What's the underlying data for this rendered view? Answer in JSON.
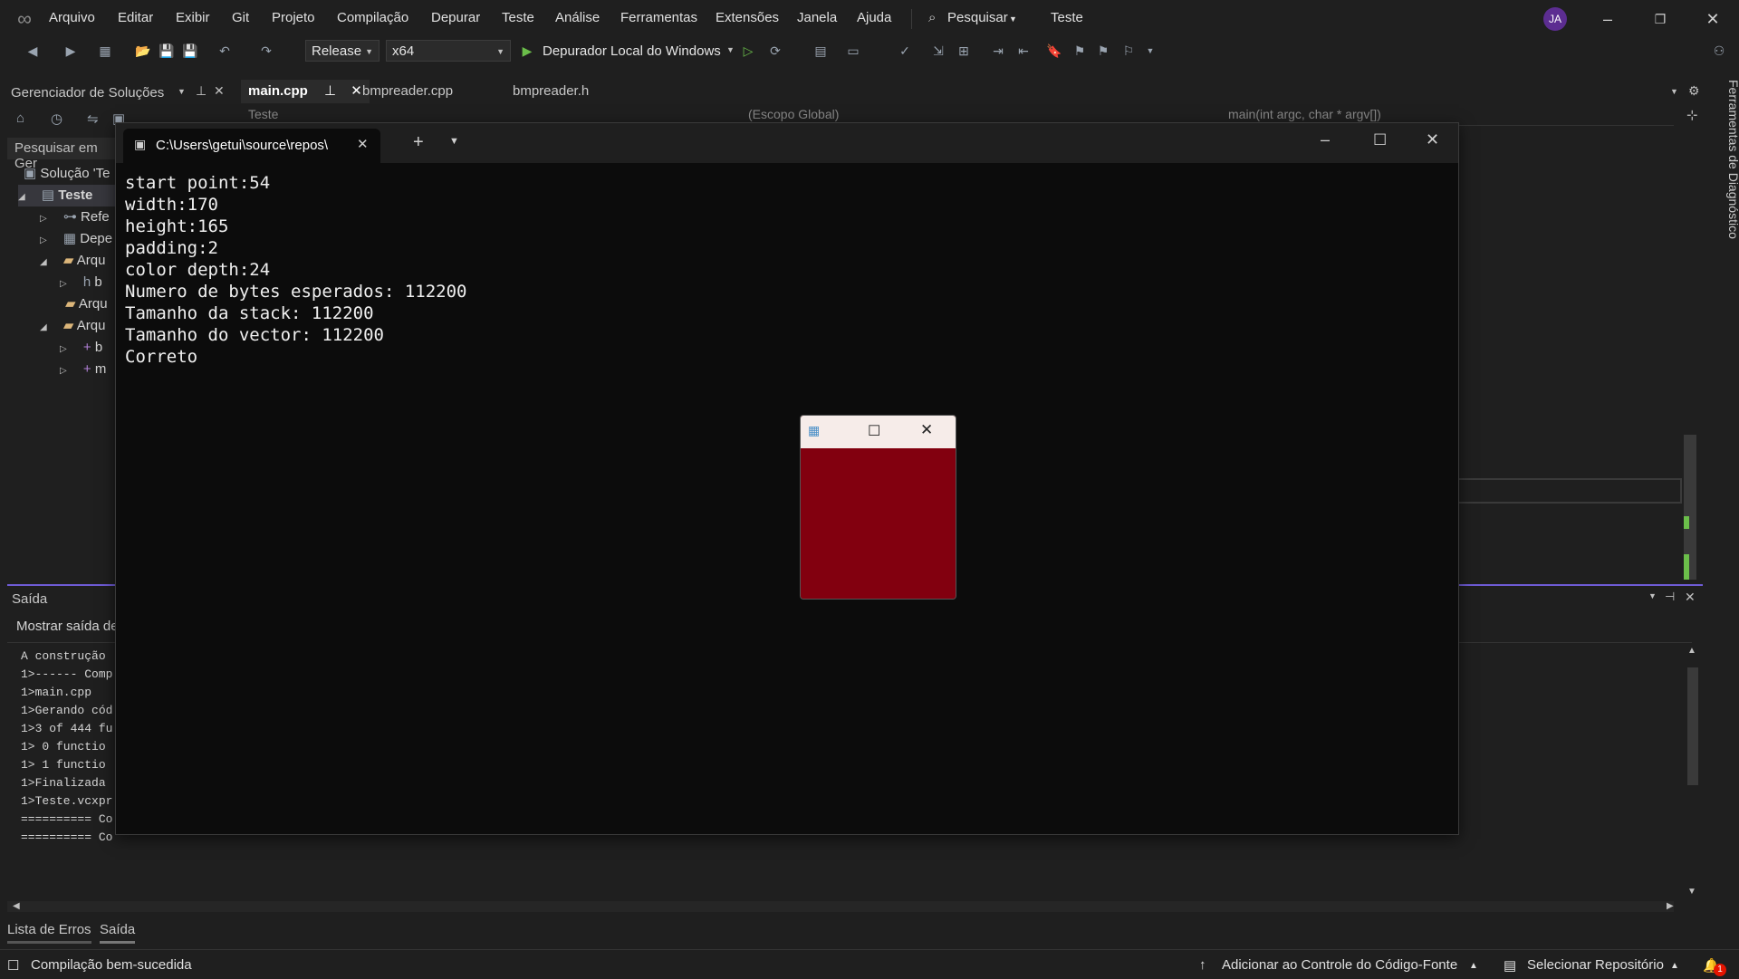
{
  "menu": {
    "items": [
      "Arquivo",
      "Editar",
      "Exibir",
      "Git",
      "Projeto",
      "Compilação",
      "Depurar",
      "Teste",
      "Análise",
      "Ferramentas",
      "Extensões",
      "Janela",
      "Ajuda"
    ],
    "search_label": "Pesquisar",
    "solution_name": "Teste",
    "avatar_initials": "JA"
  },
  "toolbar": {
    "config": "Release",
    "platform": "x64",
    "run_label": "Depurador Local do Windows"
  },
  "solution_explorer": {
    "title": "Gerenciador de Soluções",
    "search_placeholder": "Pesquisar em Ger",
    "solution_label": "Solução 'Te",
    "project": "Teste",
    "nodes": [
      "Refe",
      "Depe",
      "Arqu",
      "b",
      "Arqu",
      "Arqu",
      "b",
      "m"
    ]
  },
  "editor": {
    "tabs": [
      "main.cpp",
      "bmpreader.cpp",
      "bmpreader.h"
    ],
    "nav_project": "Teste",
    "nav_scope": "(Escopo Global)",
    "nav_function": "main(int argc, char * argv[])"
  },
  "right_sidebar_label": "Ferramentas de Diagnóstico",
  "output": {
    "title": "Saída",
    "show_output_from": "Mostrar saída de",
    "lines": [
      "A construção",
      "1>------ Comp",
      "1>main.cpp",
      "1>Gerando cód",
      "1>3 of 444 fu",
      "1>  0 functio",
      "1>  1 functio",
      "1>Finalizada",
      "1>Teste.vcxpr",
      "========== Co",
      "========== Co"
    ]
  },
  "bottom_tabs": [
    "Lista de Erros",
    "Saída"
  ],
  "terminal": {
    "tab_title": "C:\\Users\\getui\\source\\repos\\",
    "lines": [
      "start point:54",
      "width:170",
      "height:165",
      "padding:2",
      "color depth:24",
      "Numero de bytes esperados: 112200",
      "Tamanho da stack: 112200",
      "Tamanho do vector: 112200",
      "Correto"
    ]
  },
  "popup": {
    "fill_color": "#82000f"
  },
  "status": {
    "build_message": "Compilação bem-sucedida",
    "source_control": "Adicionar ao Controle do Código-Fonte",
    "repository": "Selecionar Repositório",
    "notifications": "1"
  },
  "colors": {
    "accent": "#6e5bd4",
    "run_green": "#6bbe4a",
    "terminal_bg": "#0c0c0c",
    "popup_fill": "#82000f"
  }
}
